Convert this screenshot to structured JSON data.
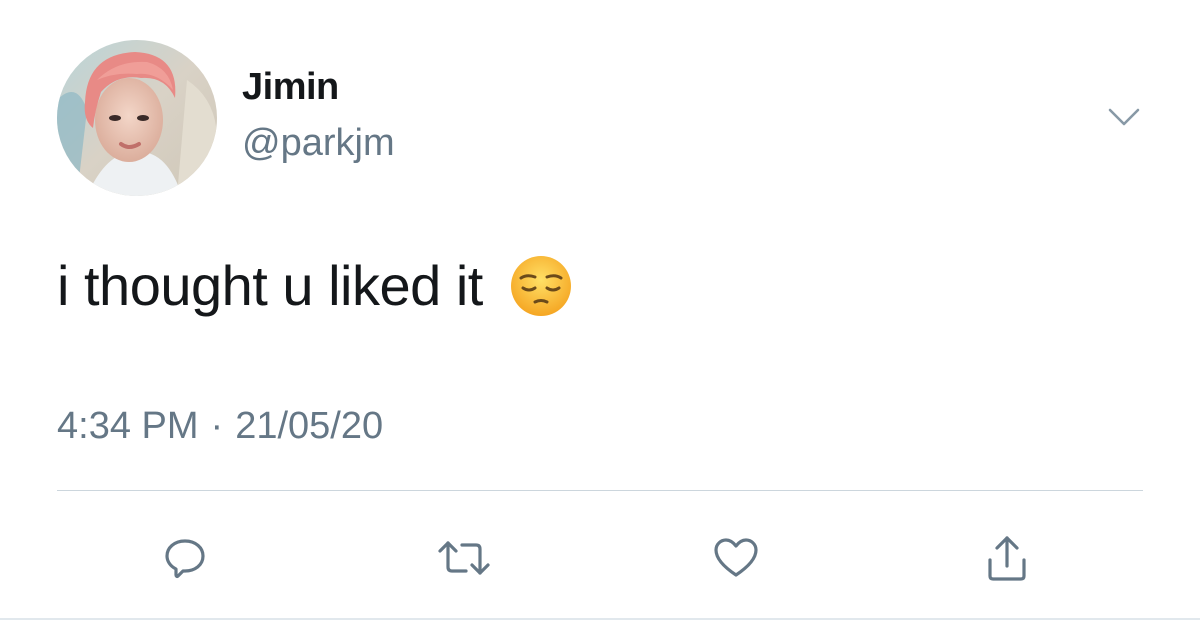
{
  "author": {
    "name": "Jimin",
    "handle": "@parkjm"
  },
  "tweet": {
    "text": "i thought u liked it",
    "emoji": "pensive-face-emoji"
  },
  "meta": {
    "time": "4:34 PM",
    "separator": "·",
    "date": "21/05/20"
  },
  "actions": [
    {
      "name": "reply",
      "icon": "speech-bubble-icon"
    },
    {
      "name": "retweet",
      "icon": "retweet-icon"
    },
    {
      "name": "like",
      "icon": "heart-icon"
    },
    {
      "name": "share",
      "icon": "share-icon"
    }
  ],
  "colors": {
    "text": "#14171a",
    "secondary": "#657786",
    "divider": "#ccd6dd",
    "icon": "#657786"
  }
}
